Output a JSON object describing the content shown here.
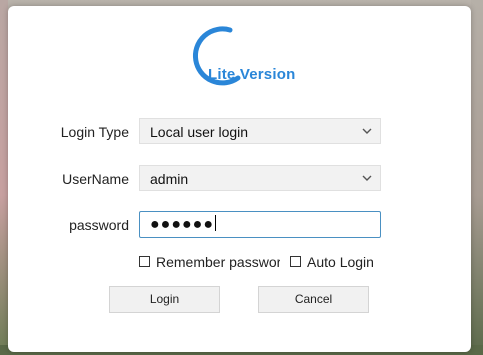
{
  "logo": {
    "text": "Lite Version",
    "color": "#2a86d8"
  },
  "form": {
    "login_type": {
      "label": "Login Type",
      "value": "Local user login"
    },
    "username": {
      "label": "UserName",
      "value": "admin"
    },
    "password": {
      "label": "password",
      "value": "●●●●●●"
    }
  },
  "options": {
    "remember_password": {
      "label": "Remember password",
      "checked": false
    },
    "auto_login": {
      "label": "Auto Login",
      "checked": false
    }
  },
  "buttons": {
    "login": "Login",
    "cancel": "Cancel"
  }
}
